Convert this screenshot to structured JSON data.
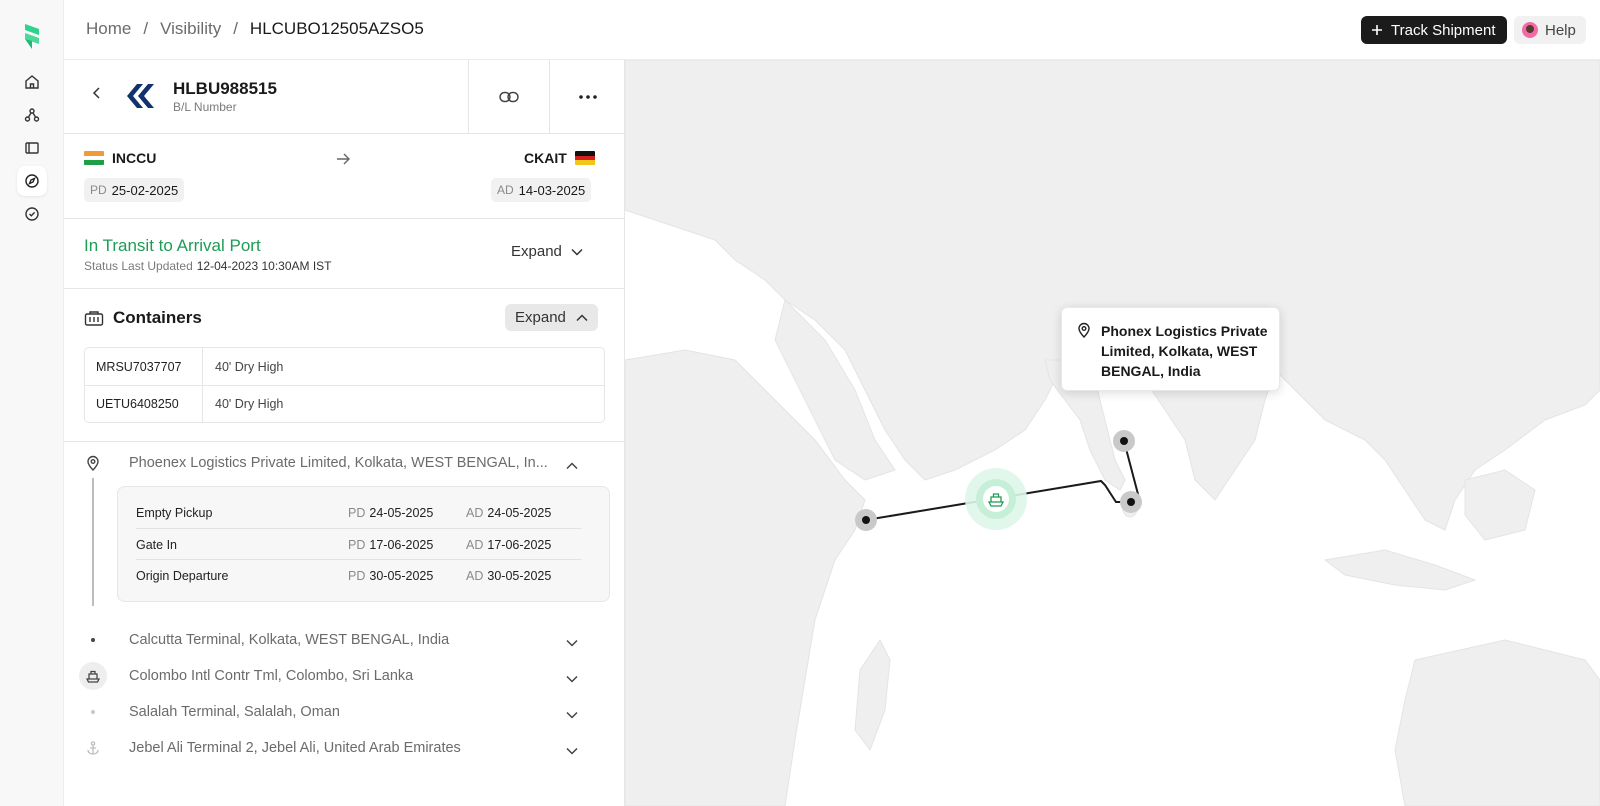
{
  "breadcrumb": {
    "home": "Home",
    "visibility": "Visibility",
    "current": "HLCUBO12505AZSO5",
    "separator": "/"
  },
  "header": {
    "track_label": "Track Shipment",
    "help_label": "Help"
  },
  "shipment": {
    "bl_number": "HLBU988515",
    "bl_label": "B/L Number",
    "origin": {
      "code": "INCCU",
      "tag": "PD",
      "date": "25-02-2025"
    },
    "destination": {
      "code": "CKAIT",
      "tag": "AD",
      "date": "14-03-2025"
    }
  },
  "status": {
    "title": "In Transit to Arrival Port",
    "updated_label": "Status Last Updated",
    "updated_value": "12-04-2023 10:30AM IST",
    "expand_label": "Expand"
  },
  "containers": {
    "title": "Containers",
    "expand_label": "Expand",
    "rows": [
      {
        "id": "MRSU7037707",
        "type": "40' Dry High"
      },
      {
        "id": "UETU6408250",
        "type": "40' Dry High"
      }
    ]
  },
  "timeline": {
    "stops": [
      {
        "label": "Phoenex Logistics Private Limited, Kolkata, WEST BENGAL, In...",
        "icon": "location-pin-icon"
      },
      {
        "label": "Calcutta Terminal, Kolkata, WEST BENGAL, India",
        "icon": "dot-icon"
      },
      {
        "label": "Colombo Intl Contr Tml, Colombo, Sri Lanka",
        "icon": "ship-icon"
      },
      {
        "label": "Salalah Terminal, Salalah, Oman",
        "icon": "dot-icon"
      },
      {
        "label": "Jebel Ali Terminal 2, Jebel Ali, United Arab Emirates",
        "icon": "anchor-icon"
      }
    ],
    "events": [
      {
        "name": "Empty Pickup",
        "pd_tag": "PD",
        "pd": "24-05-2025",
        "ad_tag": "AD",
        "ad": "24-05-2025"
      },
      {
        "name": "Gate In",
        "pd_tag": "PD",
        "pd": "17-06-2025",
        "ad_tag": "AD",
        "ad": "17-06-2025"
      },
      {
        "name": "Origin Departure",
        "pd_tag": "PD",
        "pd": "30-05-2025",
        "ad_tag": "AD",
        "ad": "30-05-2025"
      }
    ]
  },
  "map": {
    "tooltip": "Phonex Logistics Private Limited, Kolkata, WEST BENGAL, India",
    "colors": {
      "land": "#efefef",
      "route": "#1a1a1a",
      "vessel": "#1e9c56"
    }
  },
  "colors": {
    "accent": "#1e9c56",
    "brand": "#2bd48a",
    "carrier": "#12326b"
  }
}
